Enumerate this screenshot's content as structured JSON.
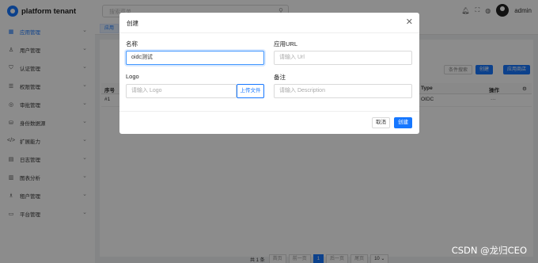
{
  "app": {
    "title": "platform tenant",
    "user": "admin"
  },
  "search": {
    "placeholder": "搜索菜单"
  },
  "sidebar": {
    "items": [
      {
        "label": "应用管理",
        "icon": "grid-icon",
        "active": true
      },
      {
        "label": "用户管理",
        "icon": "user-icon"
      },
      {
        "label": "认证管理",
        "icon": "shield-icon"
      },
      {
        "label": "权限管理",
        "icon": "list-icon"
      },
      {
        "label": "审批管理",
        "icon": "check-circle-icon"
      },
      {
        "label": "身份数据源",
        "icon": "database-icon"
      },
      {
        "label": "扩展能力",
        "icon": "code-icon"
      },
      {
        "label": "日志管理",
        "icon": "file-icon"
      },
      {
        "label": "图表分析",
        "icon": "bar-chart-icon"
      },
      {
        "label": "租户管理",
        "icon": "team-icon"
      },
      {
        "label": "平台管理",
        "icon": "window-icon"
      }
    ]
  },
  "tabs": {
    "active": "应用"
  },
  "toolbar": {
    "filter": "条件搜索",
    "create": "创建",
    "store": "应用商店"
  },
  "table": {
    "headers": {
      "index": "序号",
      "type": "Type",
      "actions": "操作"
    },
    "rows": [
      {
        "index": "#1",
        "type": "OIDC",
        "actions": "···"
      }
    ]
  },
  "pagination": {
    "total": "共 1 条",
    "first": "首页",
    "prev": "前一页",
    "current": "1",
    "next": "后一页",
    "last": "尾页",
    "size": "10"
  },
  "modal": {
    "title": "创建",
    "fields": {
      "name": {
        "label": "名称",
        "value": "oidc测试"
      },
      "url": {
        "label": "应用URL",
        "placeholder": "请输入 Url"
      },
      "logo": {
        "label": "Logo",
        "placeholder": "请输入 Logo",
        "upload": "上传文件"
      },
      "remark": {
        "label": "备注",
        "placeholder": "请输入 Description"
      }
    },
    "cancel": "取消",
    "ok": "创建"
  },
  "watermark": "CSDN @龙归CEO",
  "colors": {
    "primary": "#1677ff"
  }
}
